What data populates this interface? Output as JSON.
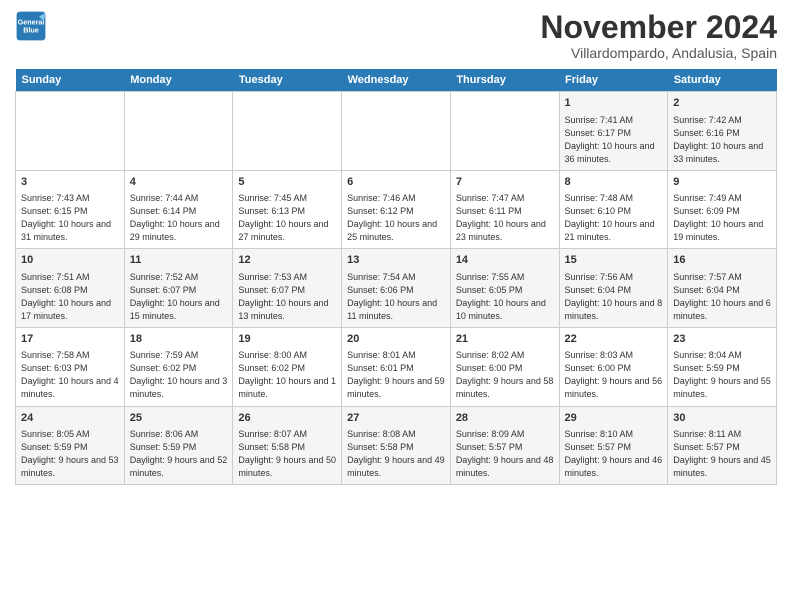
{
  "header": {
    "logo_line1": "General",
    "logo_line2": "Blue",
    "title": "November 2024",
    "subtitle": "Villardompardo, Andalusia, Spain"
  },
  "days_of_week": [
    "Sunday",
    "Monday",
    "Tuesday",
    "Wednesday",
    "Thursday",
    "Friday",
    "Saturday"
  ],
  "weeks": [
    [
      {
        "day": "",
        "info": ""
      },
      {
        "day": "",
        "info": ""
      },
      {
        "day": "",
        "info": ""
      },
      {
        "day": "",
        "info": ""
      },
      {
        "day": "",
        "info": ""
      },
      {
        "day": "1",
        "info": "Sunrise: 7:41 AM\nSunset: 6:17 PM\nDaylight: 10 hours and 36 minutes."
      },
      {
        "day": "2",
        "info": "Sunrise: 7:42 AM\nSunset: 6:16 PM\nDaylight: 10 hours and 33 minutes."
      }
    ],
    [
      {
        "day": "3",
        "info": "Sunrise: 7:43 AM\nSunset: 6:15 PM\nDaylight: 10 hours and 31 minutes."
      },
      {
        "day": "4",
        "info": "Sunrise: 7:44 AM\nSunset: 6:14 PM\nDaylight: 10 hours and 29 minutes."
      },
      {
        "day": "5",
        "info": "Sunrise: 7:45 AM\nSunset: 6:13 PM\nDaylight: 10 hours and 27 minutes."
      },
      {
        "day": "6",
        "info": "Sunrise: 7:46 AM\nSunset: 6:12 PM\nDaylight: 10 hours and 25 minutes."
      },
      {
        "day": "7",
        "info": "Sunrise: 7:47 AM\nSunset: 6:11 PM\nDaylight: 10 hours and 23 minutes."
      },
      {
        "day": "8",
        "info": "Sunrise: 7:48 AM\nSunset: 6:10 PM\nDaylight: 10 hours and 21 minutes."
      },
      {
        "day": "9",
        "info": "Sunrise: 7:49 AM\nSunset: 6:09 PM\nDaylight: 10 hours and 19 minutes."
      }
    ],
    [
      {
        "day": "10",
        "info": "Sunrise: 7:51 AM\nSunset: 6:08 PM\nDaylight: 10 hours and 17 minutes."
      },
      {
        "day": "11",
        "info": "Sunrise: 7:52 AM\nSunset: 6:07 PM\nDaylight: 10 hours and 15 minutes."
      },
      {
        "day": "12",
        "info": "Sunrise: 7:53 AM\nSunset: 6:07 PM\nDaylight: 10 hours and 13 minutes."
      },
      {
        "day": "13",
        "info": "Sunrise: 7:54 AM\nSunset: 6:06 PM\nDaylight: 10 hours and 11 minutes."
      },
      {
        "day": "14",
        "info": "Sunrise: 7:55 AM\nSunset: 6:05 PM\nDaylight: 10 hours and 10 minutes."
      },
      {
        "day": "15",
        "info": "Sunrise: 7:56 AM\nSunset: 6:04 PM\nDaylight: 10 hours and 8 minutes."
      },
      {
        "day": "16",
        "info": "Sunrise: 7:57 AM\nSunset: 6:04 PM\nDaylight: 10 hours and 6 minutes."
      }
    ],
    [
      {
        "day": "17",
        "info": "Sunrise: 7:58 AM\nSunset: 6:03 PM\nDaylight: 10 hours and 4 minutes."
      },
      {
        "day": "18",
        "info": "Sunrise: 7:59 AM\nSunset: 6:02 PM\nDaylight: 10 hours and 3 minutes."
      },
      {
        "day": "19",
        "info": "Sunrise: 8:00 AM\nSunset: 6:02 PM\nDaylight: 10 hours and 1 minute."
      },
      {
        "day": "20",
        "info": "Sunrise: 8:01 AM\nSunset: 6:01 PM\nDaylight: 9 hours and 59 minutes."
      },
      {
        "day": "21",
        "info": "Sunrise: 8:02 AM\nSunset: 6:00 PM\nDaylight: 9 hours and 58 minutes."
      },
      {
        "day": "22",
        "info": "Sunrise: 8:03 AM\nSunset: 6:00 PM\nDaylight: 9 hours and 56 minutes."
      },
      {
        "day": "23",
        "info": "Sunrise: 8:04 AM\nSunset: 5:59 PM\nDaylight: 9 hours and 55 minutes."
      }
    ],
    [
      {
        "day": "24",
        "info": "Sunrise: 8:05 AM\nSunset: 5:59 PM\nDaylight: 9 hours and 53 minutes."
      },
      {
        "day": "25",
        "info": "Sunrise: 8:06 AM\nSunset: 5:59 PM\nDaylight: 9 hours and 52 minutes."
      },
      {
        "day": "26",
        "info": "Sunrise: 8:07 AM\nSunset: 5:58 PM\nDaylight: 9 hours and 50 minutes."
      },
      {
        "day": "27",
        "info": "Sunrise: 8:08 AM\nSunset: 5:58 PM\nDaylight: 9 hours and 49 minutes."
      },
      {
        "day": "28",
        "info": "Sunrise: 8:09 AM\nSunset: 5:57 PM\nDaylight: 9 hours and 48 minutes."
      },
      {
        "day": "29",
        "info": "Sunrise: 8:10 AM\nSunset: 5:57 PM\nDaylight: 9 hours and 46 minutes."
      },
      {
        "day": "30",
        "info": "Sunrise: 8:11 AM\nSunset: 5:57 PM\nDaylight: 9 hours and 45 minutes."
      }
    ]
  ],
  "colors": {
    "header_bg": "#2a7ab5",
    "header_text": "#ffffff",
    "odd_row": "#f5f5f5",
    "even_row": "#ffffff"
  }
}
